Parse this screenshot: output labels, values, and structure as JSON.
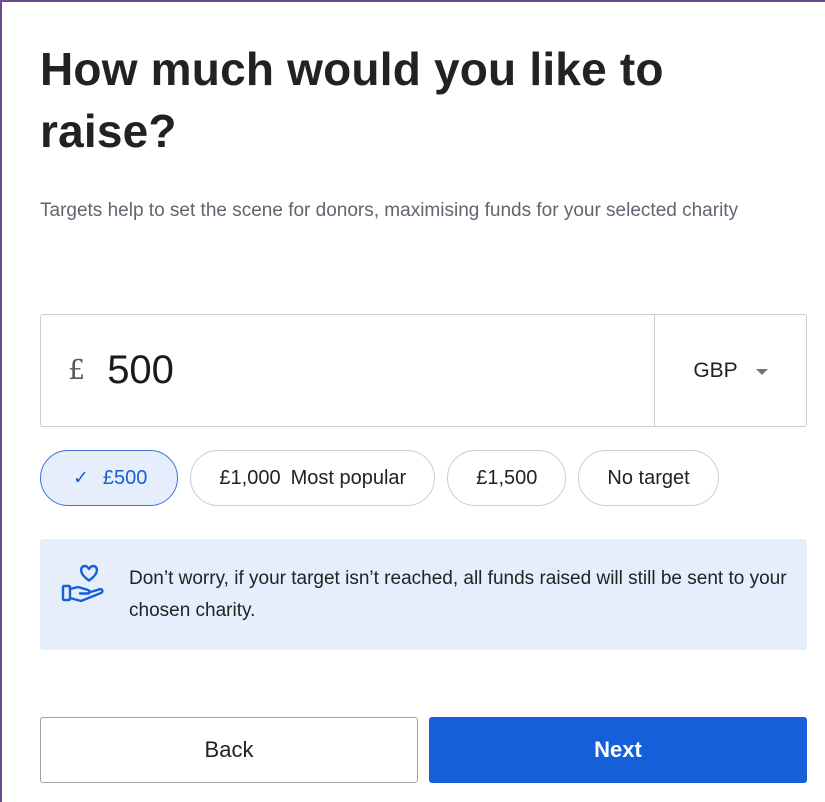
{
  "page": {
    "title": "How much would you like to raise?",
    "subtitle": "Targets help to set the scene for donors, maximising funds for your selected charity"
  },
  "amount": {
    "currency_symbol": "£",
    "value": "500",
    "currency_code": "GBP"
  },
  "chips": [
    {
      "label": "£500",
      "selected": true
    },
    {
      "label": "£1,000",
      "tag": "Most popular",
      "selected": false
    },
    {
      "label": "£1,500",
      "selected": false
    },
    {
      "label": "No target",
      "selected": false
    }
  ],
  "info": {
    "icon": "hand-heart-icon",
    "text": "Don’t worry, if your target isn’t reached, all funds raised will still be sent to your chosen charity."
  },
  "buttons": {
    "back_label": "Back",
    "next_label": "Next"
  },
  "colors": {
    "primary": "#1560d8",
    "info_background": "#e6eefb",
    "selected_chip_border": "#3f74d4"
  }
}
